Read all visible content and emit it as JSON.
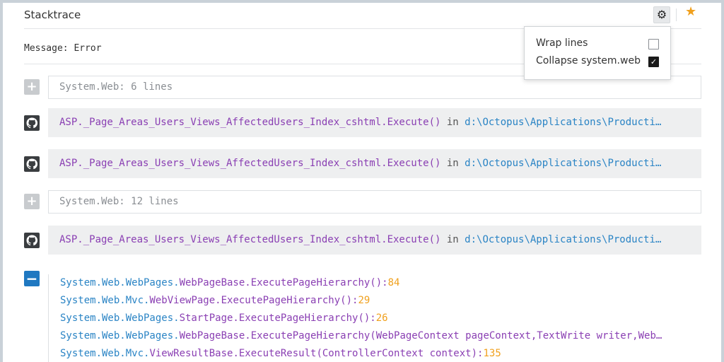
{
  "header": {
    "title": "Stacktrace"
  },
  "message": {
    "label": "Message: Error"
  },
  "rows": {
    "collapsed1": {
      "text": "System.Web: 6 lines"
    },
    "frame1": {
      "fn": "ASP._Page_Areas_Users_Views_AffectedUsers_Index_cshtml.Execute()",
      "in": " in ",
      "path": "d:\\Octopus\\Applications\\Producti…"
    },
    "frame2": {
      "fn": "ASP._Page_Areas_Users_Views_AffectedUsers_Index_cshtml.Execute()",
      "in": " in ",
      "path": "d:\\Octopus\\Applications\\Producti…"
    },
    "collapsed2": {
      "text": "System.Web:  12 lines"
    },
    "frame3": {
      "fn": "ASP._Page_Areas_Users_Views_AffectedUsers_Index_cshtml.Execute()",
      "in": " in ",
      "path": "d:\\Octopus\\Applications\\Producti…"
    }
  },
  "expanded": {
    "lines": [
      {
        "ns": "System.Web.WebPages.",
        "cls": "WebPageBase.ExecutePageHierarchy()",
        "sep": ":",
        "line": "84"
      },
      {
        "ns": "System.Web.Mvc.",
        "cls": "WebViewPage.ExecutePageHierarchy()",
        "sep": ":",
        "line": "29"
      },
      {
        "ns": "System.Web.WebPages.",
        "cls": "StartPage.ExecutePageHierarchy()",
        "sep": ":",
        "line": "26"
      },
      {
        "ns": "System.Web.WebPages.",
        "cls": "WebPageBase.ExecutePageHierarchy(WebPageContext pageContext,TextWrite writer,Web…",
        "sep": "",
        "line": ""
      },
      {
        "ns": "System.Web.Mvc.",
        "cls": "ViewResultBase.ExecuteResult(ControllerContext context)",
        "sep": ":",
        "line": "135"
      }
    ]
  },
  "dropdown": {
    "wrap_label": "Wrap lines",
    "wrap_checked": false,
    "collapse_label": "Collapse system.web",
    "collapse_checked": true
  },
  "icons": {
    "settings": "gear-icon",
    "favorite": "star-icon",
    "expand": "plus-icon",
    "collapse": "minus-icon",
    "source": "github-icon"
  },
  "colors": {
    "accent": "#1f78c1",
    "star": "#f0a01d",
    "function": "#8a3fb3",
    "path": "#2a84c5",
    "line_number": "#f0a01d"
  }
}
